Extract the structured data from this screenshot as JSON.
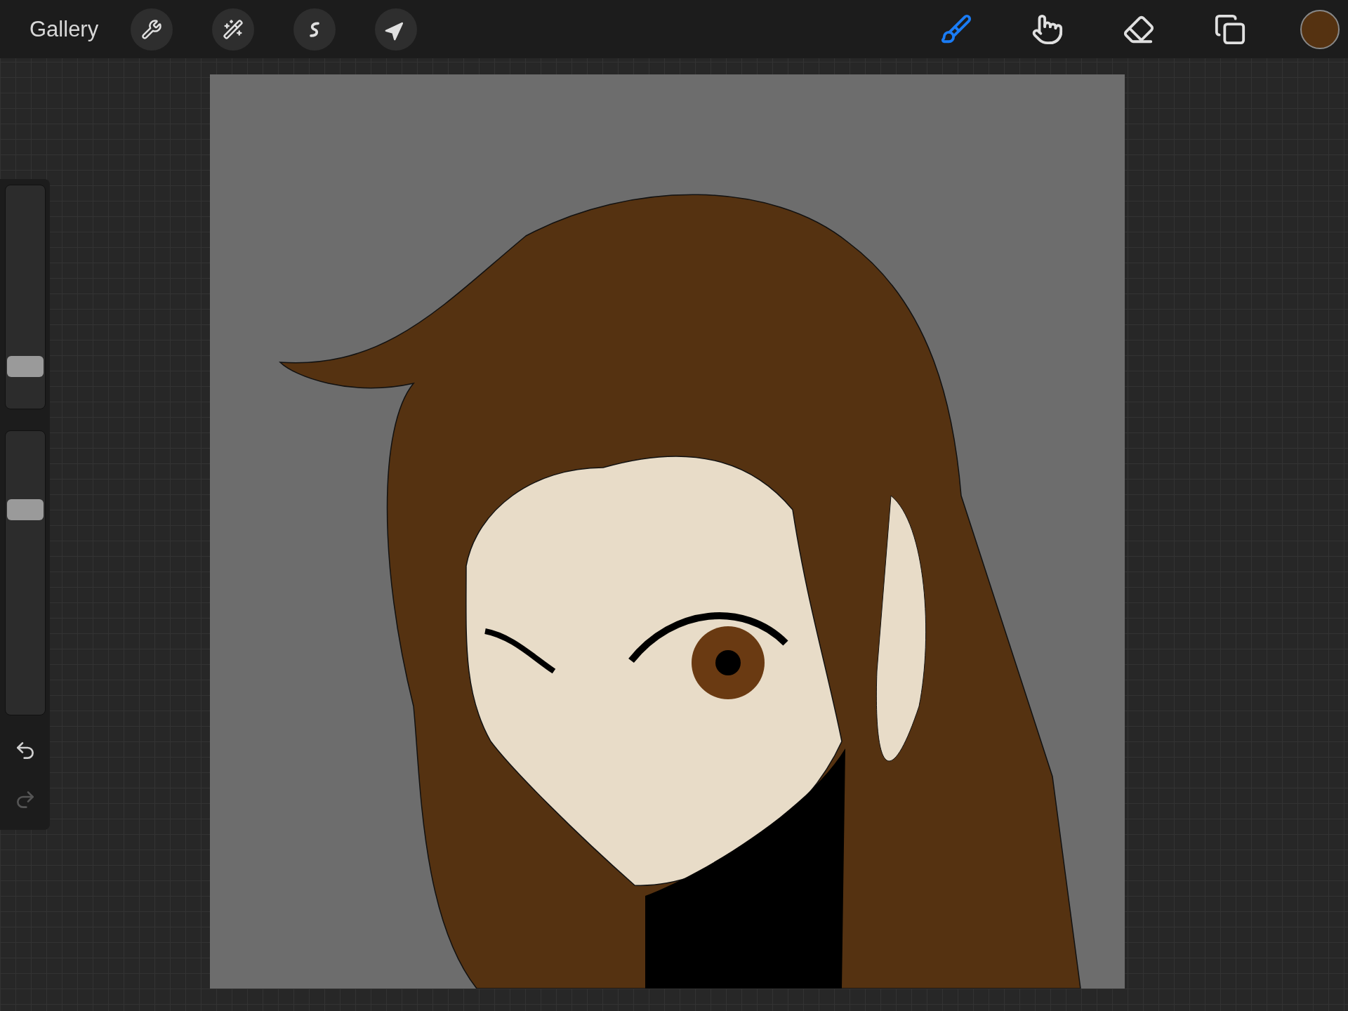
{
  "top_bar": {
    "gallery": "Gallery",
    "actions": [
      {
        "kind": "wrench"
      },
      {
        "kind": "wand"
      },
      {
        "kind": "selection"
      },
      {
        "kind": "transform"
      }
    ],
    "tools": [
      {
        "kind": "brush",
        "selected": true
      },
      {
        "kind": "smudge",
        "selected": false
      },
      {
        "kind": "eraser",
        "selected": false
      },
      {
        "kind": "layers",
        "selected": false
      }
    ],
    "color_swatch": {
      "color": "#553211"
    }
  },
  "sidebar": {
    "sliders": [
      {
        "level": 0.15
      },
      {
        "level": 0.74
      }
    ],
    "history": [
      {
        "kind": "undo",
        "disabled": false
      },
      {
        "kind": "redo",
        "disabled": true
      }
    ]
  }
}
